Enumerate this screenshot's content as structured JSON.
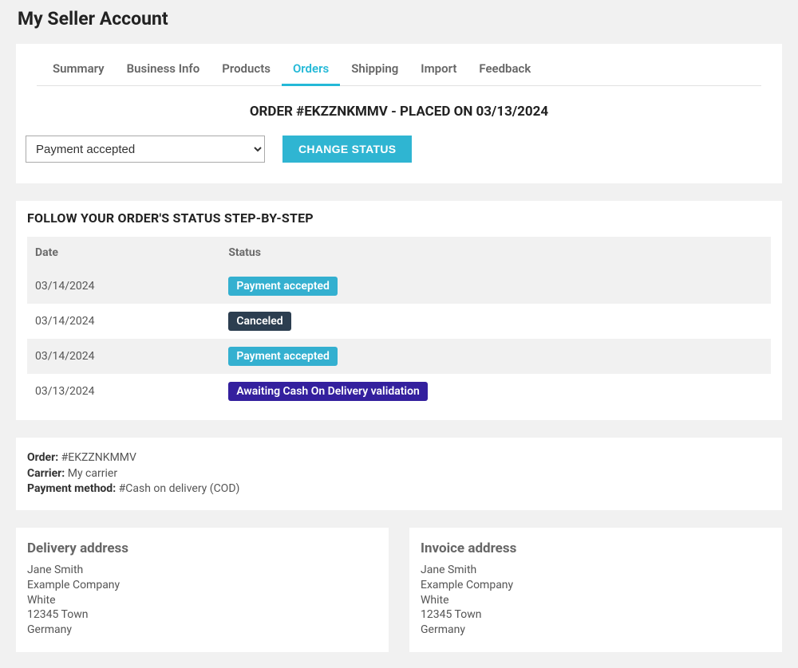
{
  "page": {
    "title": "My Seller Account"
  },
  "tabs": [
    {
      "label": "Summary",
      "active": false
    },
    {
      "label": "Business Info",
      "active": false
    },
    {
      "label": "Products",
      "active": false
    },
    {
      "label": "Orders",
      "active": true
    },
    {
      "label": "Shipping",
      "active": false
    },
    {
      "label": "Import",
      "active": false
    },
    {
      "label": "Feedback",
      "active": false
    }
  ],
  "order": {
    "header": "ORDER #EKZZNKMMV - PLACED ON 03/13/2024",
    "status_select_value": "Payment accepted",
    "change_status_label": "CHANGE STATUS"
  },
  "history": {
    "title": "FOLLOW YOUR ORDER'S STATUS STEP-BY-STEP",
    "columns": {
      "date": "Date",
      "status": "Status"
    },
    "rows": [
      {
        "date": "03/14/2024",
        "status": "Payment accepted",
        "badgeClass": "badge-payment"
      },
      {
        "date": "03/14/2024",
        "status": "Canceled",
        "badgeClass": "badge-canceled"
      },
      {
        "date": "03/14/2024",
        "status": "Payment accepted",
        "badgeClass": "badge-payment"
      },
      {
        "date": "03/13/2024",
        "status": "Awaiting Cash On Delivery validation",
        "badgeClass": "badge-awaiting"
      }
    ]
  },
  "summary": {
    "order_label": "Order:",
    "order_value": "#EKZZNKMMV",
    "carrier_label": "Carrier:",
    "carrier_value": "My carrier",
    "payment_label": "Payment method:",
    "payment_value": "#Cash on delivery (COD)"
  },
  "addresses": {
    "delivery": {
      "title": "Delivery address",
      "name": "Jane Smith",
      "company": "Example Company",
      "line": "White",
      "city": "12345 Town",
      "country": "Germany"
    },
    "invoice": {
      "title": "Invoice address",
      "name": "Jane Smith",
      "company": "Example Company",
      "line": "White",
      "city": "12345 Town",
      "country": "Germany"
    }
  }
}
